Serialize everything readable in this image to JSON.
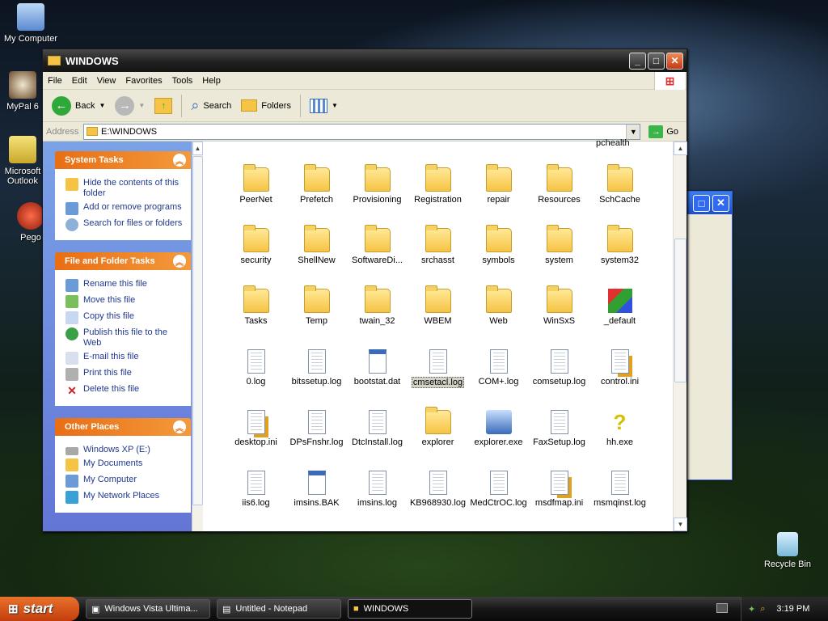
{
  "desktop": {
    "icons": [
      {
        "label": "My Computer"
      },
      {
        "label": "MyPal 6"
      },
      {
        "label": "Microsoft Outlook"
      },
      {
        "label": "Pego"
      },
      {
        "label": "Recycle Bin"
      }
    ]
  },
  "window": {
    "title": "WINDOWS"
  },
  "menu": {
    "file": "File",
    "edit": "Edit",
    "view": "View",
    "favorites": "Favorites",
    "tools": "Tools",
    "help": "Help"
  },
  "toolbar": {
    "back": "Back",
    "search": "Search",
    "folders": "Folders"
  },
  "address": {
    "label": "Address",
    "value": "E:\\WINDOWS",
    "go": "Go"
  },
  "system_tasks": {
    "title": "System Tasks",
    "items": [
      "Hide the contents of this folder",
      "Add or remove programs",
      "Search for files or folders"
    ]
  },
  "file_tasks": {
    "title": "File and Folder Tasks",
    "items": [
      "Rename this file",
      "Move this file",
      "Copy this file",
      "Publish this file to the Web",
      "E-mail this file",
      "Print this file",
      "Delete this file"
    ]
  },
  "other_places": {
    "title": "Other Places",
    "items": [
      "Windows XP (E:)",
      "My Documents",
      "My Computer",
      "My Network Places"
    ]
  },
  "files": {
    "partial": "pchealth",
    "rows": [
      [
        "PeerNet",
        "Prefetch",
        "Provisioning",
        "Registration",
        "repair",
        "Resources",
        "SchCache"
      ],
      [
        "security",
        "ShellNew",
        "SoftwareDi...",
        "srchasst",
        "symbols",
        "system",
        "system32"
      ],
      [
        "Tasks",
        "Temp",
        "twain_32",
        "WBEM",
        "Web",
        "WinSxS",
        "_default"
      ],
      [
        "0.log",
        "bitssetup.log",
        "bootstat.dat",
        "cmsetacl.log",
        "COM+.log",
        "comsetup.log",
        "control.ini"
      ],
      [
        "desktop.ini",
        "DPsFnshr.log",
        "DtcInstall.log",
        "explorer",
        "explorer.exe",
        "FaxSetup.log",
        "hh.exe"
      ],
      [
        "iis6.log",
        "imsins.BAK",
        "imsins.log",
        "KB968930.log",
        "MedCtrOC.log",
        "msdfmap.ini",
        "msmqinst.log"
      ]
    ]
  },
  "taskbar": {
    "start": "start",
    "tasks": [
      "Windows Vista Ultima...",
      "Untitled - Notepad",
      "WINDOWS"
    ],
    "clock": "3:19 PM"
  }
}
